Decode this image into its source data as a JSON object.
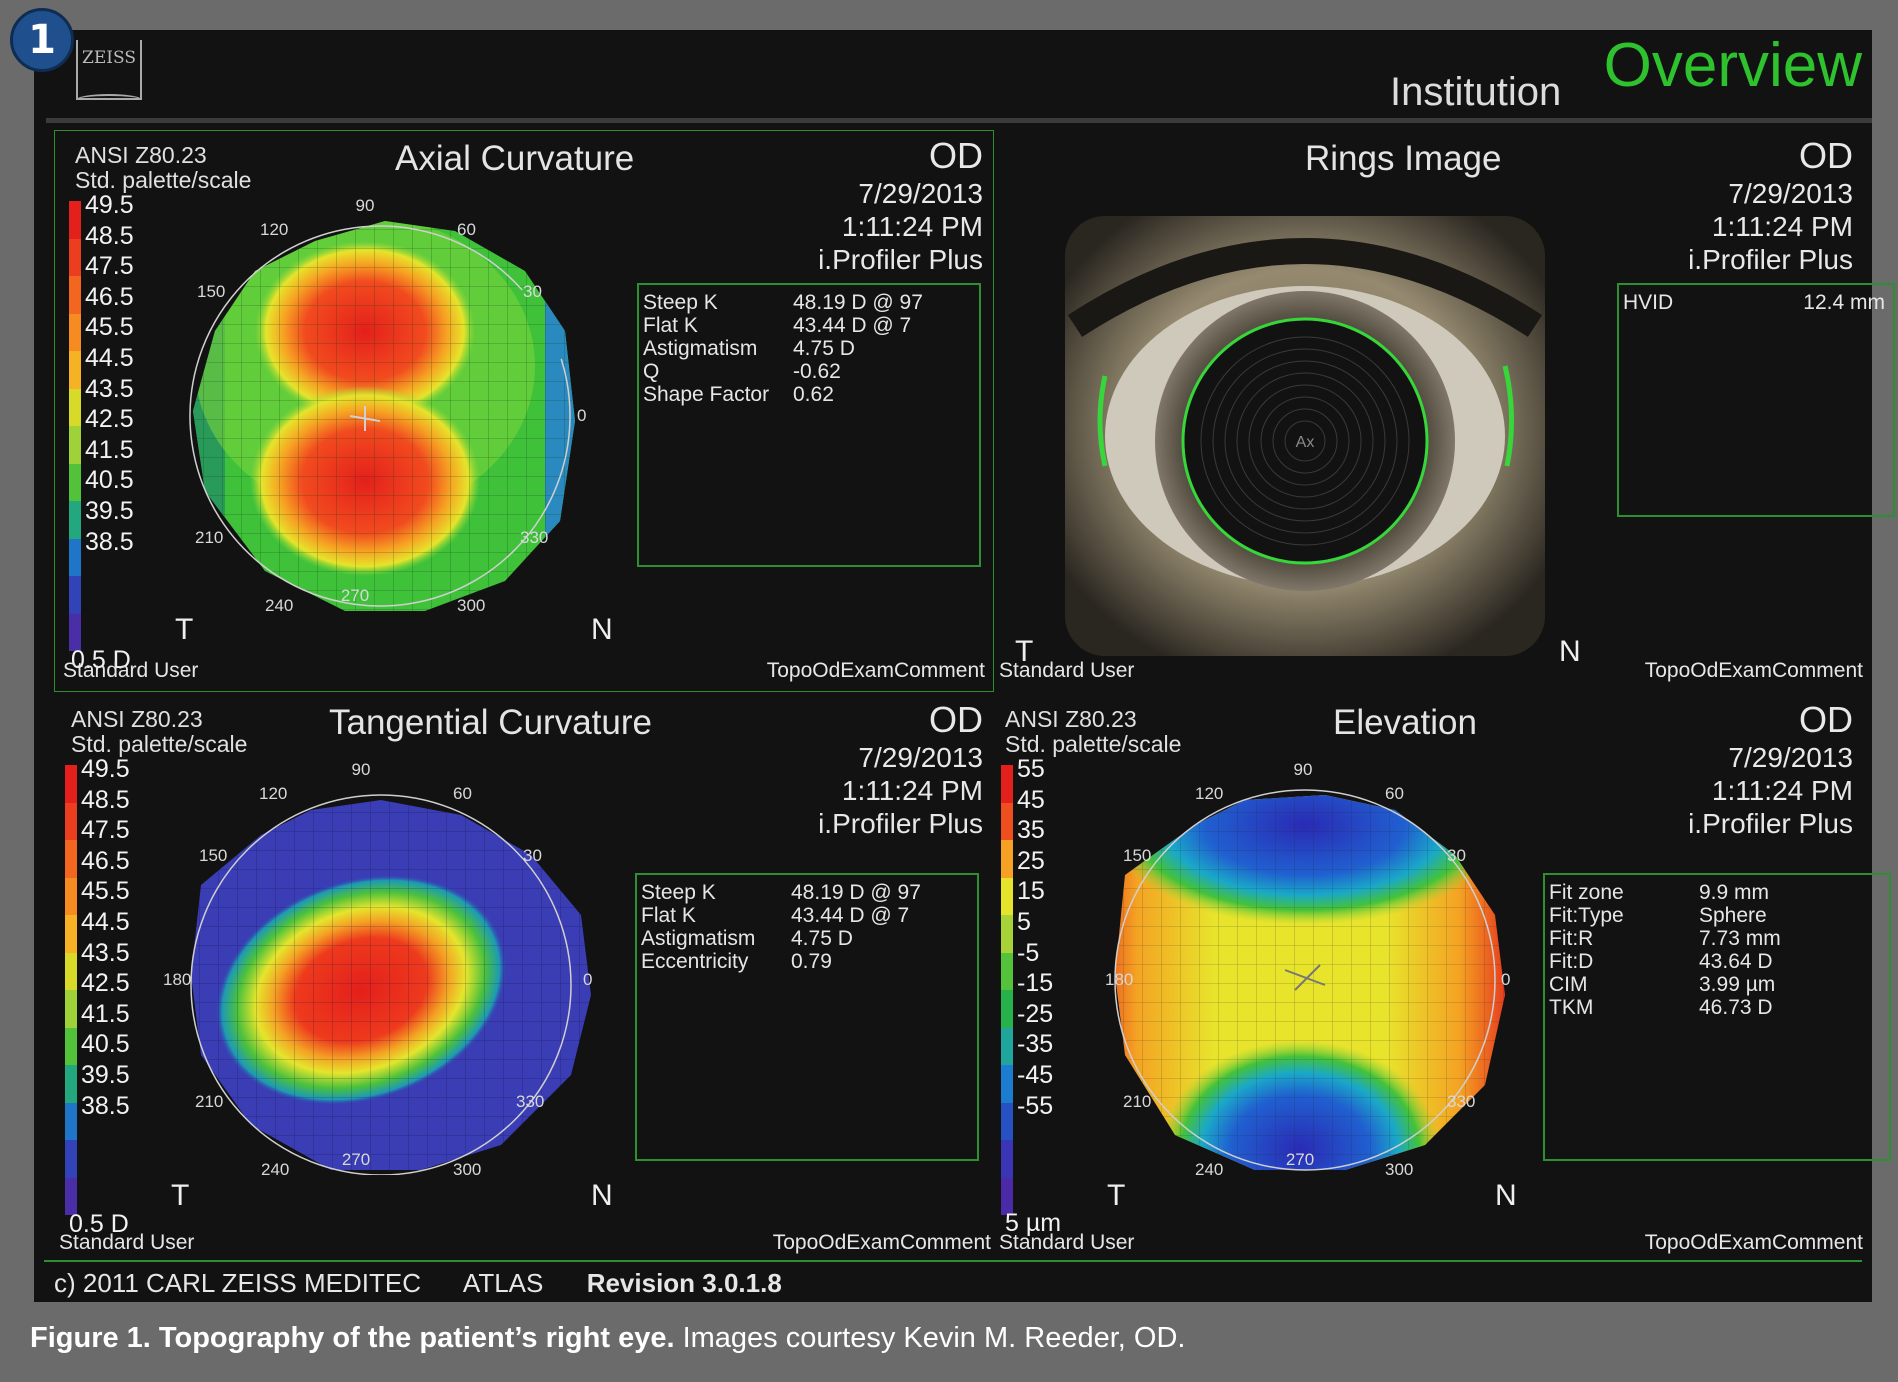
{
  "figure_number": "1",
  "header": {
    "logo": "ZEISS",
    "institution": "Institution",
    "overview": "Overview"
  },
  "common": {
    "eye": "OD",
    "date": "7/29/2013",
    "time": "1:11:24 PM",
    "device": "i.Profiler Plus",
    "standard_user": "Standard User",
    "exam_comment": "TopoOdExamComment",
    "ansi": "ANSI Z80.23",
    "palette": "Std. palette/scale",
    "temporal": "T",
    "nasal": "N"
  },
  "axial": {
    "title": "Axial Curvature",
    "scale": [
      "49.5",
      "48.5",
      "47.5",
      "46.5",
      "45.5",
      "44.5",
      "43.5",
      "42.5",
      "41.5",
      "40.5",
      "39.5",
      "38.5"
    ],
    "step": "0.5 D",
    "stats": [
      {
        "label": "Steep  K",
        "value": "48.19 D @ 97"
      },
      {
        "label": "Flat K",
        "value": "43.44 D @ 7"
      },
      {
        "label": "Astigmatism",
        "value": "4.75 D"
      },
      {
        "label": "Q",
        "value": "-0.62"
      },
      {
        "label": "Shape  Factor",
        "value": "0.62"
      }
    ]
  },
  "rings": {
    "title": "Rings Image",
    "stats": [
      {
        "label": "HVID",
        "value": "12.4 mm"
      }
    ]
  },
  "tangential": {
    "title": "Tangential Curvature",
    "scale": [
      "49.5",
      "48.5",
      "47.5",
      "46.5",
      "45.5",
      "44.5",
      "43.5",
      "42.5",
      "41.5",
      "40.5",
      "39.5",
      "38.5"
    ],
    "step": "0.5 D",
    "stats": [
      {
        "label": "Steep  K",
        "value": "48.19 D @ 97"
      },
      {
        "label": "Flat K",
        "value": "43.44 D @ 7"
      },
      {
        "label": "Astigmatism",
        "value": "4.75 D"
      },
      {
        "label": "Eccentricity",
        "value": "0.79"
      }
    ]
  },
  "elevation": {
    "title": "Elevation",
    "scale": [
      "55",
      "45",
      "35",
      "25",
      "15",
      "5",
      "-5",
      "-15",
      "-25",
      "-35",
      "-45",
      "-55"
    ],
    "step": "5 µm",
    "stats": [
      {
        "label": "Fit  zone",
        "value": "9.9 mm"
      },
      {
        "label": "Fit:Type",
        "value": "Sphere"
      },
      {
        "label": "Fit:R",
        "value": "7.73 mm"
      },
      {
        "label": "Fit:D",
        "value": "43.64 D"
      },
      {
        "label": "CIM",
        "value": "3.99 µm"
      },
      {
        "label": "TKM",
        "value": "46.73 D"
      }
    ]
  },
  "angle_labels": {
    "a90": "90",
    "a120": "120",
    "a60": "60",
    "a150": "150",
    "a30": "30",
    "a180": "180",
    "a0": "0",
    "a210": "210",
    "a330": "330",
    "a240": "240",
    "a300": "300",
    "a270": "270"
  },
  "footer": {
    "copyright": "c) 2011 CARL ZEISS MEDITEC",
    "product": "ATLAS",
    "revision": "Revision  3.0.1.8"
  },
  "caption": {
    "label": "Figure 1.",
    "bold_text": "Topography of the patient’s right eye.",
    "text": "Images courtesy Kevin M. Reeder, OD."
  },
  "colors": {
    "accent_green": "#2ec22e",
    "panel_border": "#2e8f2e"
  }
}
